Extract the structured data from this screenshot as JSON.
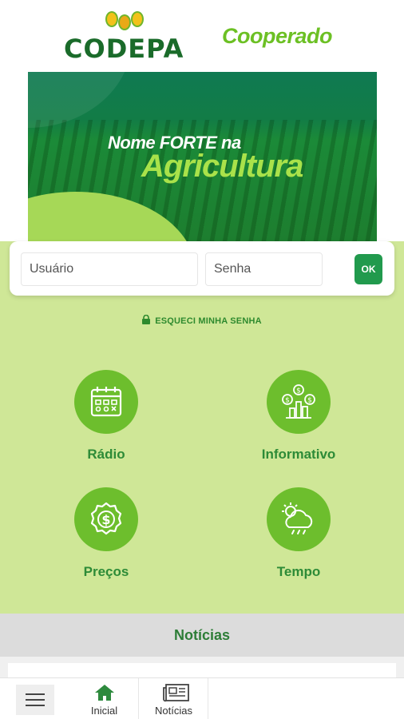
{
  "header": {
    "logo_text": "CODEPA",
    "title": "Cooperado"
  },
  "banner": {
    "line1": "Nome FORTE na",
    "line2": "Agricultura"
  },
  "login": {
    "user_placeholder": "Usuário",
    "pass_placeholder": "Senha",
    "ok_label": "OK",
    "forgot_label": "ESQUECI MINHA SENHA"
  },
  "tiles": [
    {
      "label": "Rádio",
      "icon": "calendar-icon"
    },
    {
      "label": "Informativo",
      "icon": "money-chart-icon"
    },
    {
      "label": "Preços",
      "icon": "dollar-badge-icon"
    },
    {
      "label": "Tempo",
      "icon": "weather-icon"
    }
  ],
  "news": {
    "title": "Notícias"
  },
  "tabbar": {
    "menu_icon": "hamburger-icon",
    "items": [
      {
        "label": "Inicial",
        "icon": "home-icon"
      },
      {
        "label": "Notícias",
        "icon": "newspaper-icon"
      }
    ]
  },
  "colors": {
    "brand_green": "#6cc024",
    "dark_green": "#219a4d",
    "light_green_bg": "#cfe797",
    "tile_circle": "#6dbe2d"
  }
}
